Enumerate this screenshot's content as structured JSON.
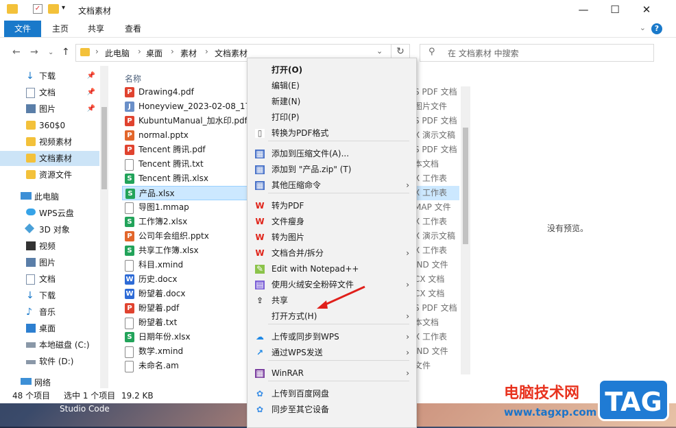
{
  "window": {
    "title": "文档素材"
  },
  "ribbon": {
    "tabs": [
      "文件",
      "主页",
      "共享",
      "查看"
    ],
    "help": "?"
  },
  "address": {
    "crumbs": [
      "此电脑",
      "桌面",
      "素材",
      "文档素材"
    ]
  },
  "search": {
    "placeholder": "在 文档素材 中搜索"
  },
  "nav": {
    "items": [
      {
        "label": "下载",
        "icon": "download-icon",
        "pinned": true
      },
      {
        "label": "文档",
        "icon": "document-icon",
        "pinned": true
      },
      {
        "label": "图片",
        "icon": "picture-icon",
        "pinned": true
      },
      {
        "label": "360$0",
        "icon": "folder-icon",
        "pinned": false
      },
      {
        "label": "视频素材",
        "icon": "folder-icon",
        "pinned": false
      },
      {
        "label": "文档素材",
        "icon": "folder-icon",
        "pinned": false,
        "selected": true
      },
      {
        "label": "资源文件",
        "icon": "folder-icon",
        "pinned": false
      },
      {
        "label": "此电脑",
        "icon": "computer-icon",
        "pinned": false
      },
      {
        "label": "WPS云盘",
        "icon": "cloud-icon",
        "pinned": false
      },
      {
        "label": "3D 对象",
        "icon": "3d-objects-icon",
        "pinned": false
      },
      {
        "label": "视频",
        "icon": "video-icon",
        "pinned": false
      },
      {
        "label": "图片",
        "icon": "picture-icon",
        "pinned": false
      },
      {
        "label": "文档",
        "icon": "document-icon",
        "pinned": false
      },
      {
        "label": "下载",
        "icon": "download-icon",
        "pinned": false
      },
      {
        "label": "音乐",
        "icon": "music-icon",
        "pinned": false
      },
      {
        "label": "桌面",
        "icon": "desktop-icon",
        "pinned": false
      },
      {
        "label": "本地磁盘 (C:)",
        "icon": "drive-icon",
        "pinned": false
      },
      {
        "label": "软件 (D:)",
        "icon": "drive-icon",
        "pinned": false
      },
      {
        "label": "网络",
        "icon": "network-icon",
        "pinned": false
      }
    ]
  },
  "files": {
    "header": "名称",
    "items": [
      {
        "name": "Drawing4.pdf",
        "type": "pdf"
      },
      {
        "name": "Honeyview_2023-02-08_171",
        "type": "jpg"
      },
      {
        "name": "KubuntuManual_加水印.pdf",
        "type": "pdf"
      },
      {
        "name": "normal.pptx",
        "type": "ppt"
      },
      {
        "name": "Tencent 腾讯.pdf",
        "type": "pdf"
      },
      {
        "name": "Tencent 腾讯.txt",
        "type": "txt"
      },
      {
        "name": "Tencent 腾讯.xlsx",
        "type": "xls"
      },
      {
        "name": "产品.xlsx",
        "type": "xls",
        "selected": true
      },
      {
        "name": "导图1.mmap",
        "type": "txt"
      },
      {
        "name": "工作簿2.xlsx",
        "type": "xls"
      },
      {
        "name": "公司年会组织.pptx",
        "type": "ppt"
      },
      {
        "name": "共享工作簿.xlsx",
        "type": "xls"
      },
      {
        "name": "科目.xmind",
        "type": "txt"
      },
      {
        "name": "历史.docx",
        "type": "doc"
      },
      {
        "name": "盼望着.docx",
        "type": "doc"
      },
      {
        "name": "盼望着.pdf",
        "type": "pdf"
      },
      {
        "name": "盼望着.txt",
        "type": "txt"
      },
      {
        "name": "日期年份.xlsx",
        "type": "xls"
      },
      {
        "name": "数学.xmind",
        "type": "txt"
      },
      {
        "name": "未命名.am",
        "type": "txt"
      }
    ]
  },
  "types": [
    "S PDF 文档",
    "图片文件",
    "S PDF 文档",
    "X 演示文稿",
    "S PDF 文档",
    "本文档",
    "X 工作表",
    "X 工作表",
    "MAP 文件",
    "X 工作表",
    "X 演示文稿",
    "X 工作表",
    "IND 文件",
    "CX 文档",
    "CX 文档",
    "S PDF 文档",
    "本文档",
    "X 工作表",
    "IND 文件",
    "文件"
  ],
  "preview": {
    "text": "没有预览。"
  },
  "status": {
    "count": "48 个项目",
    "selected": "选中 1 个项目",
    "size": "19.2 KB"
  },
  "taskbar": {
    "app": "Studio Code"
  },
  "menu": {
    "items": [
      {
        "label": "打开(O)",
        "bold": true
      },
      {
        "label": "编辑(E)"
      },
      {
        "label": "新建(N)"
      },
      {
        "label": "打印(P)"
      },
      {
        "label": "转换为PDF格式",
        "icon": "pdf-convert-icon"
      },
      {
        "label": "添加到压缩文件(A)...",
        "icon": "archive-icon"
      },
      {
        "label": "添加到 \"产品.zip\" (T)",
        "icon": "archive-icon"
      },
      {
        "label": "其他压缩命令",
        "icon": "archive-icon",
        "submenu": true
      },
      {
        "label": "转为PDF",
        "icon": "wps-icon"
      },
      {
        "label": "文件瘦身",
        "icon": "wps-icon"
      },
      {
        "label": "转为图片",
        "icon": "wps-icon"
      },
      {
        "label": "文档合并/拆分",
        "icon": "wps-icon",
        "submenu": true
      },
      {
        "label": "Edit with Notepad++",
        "icon": "notepad-icon"
      },
      {
        "label": "使用火绒安全粉碎文件",
        "icon": "shredder-icon",
        "submenu": true
      },
      {
        "label": "共享",
        "icon": "share-icon"
      },
      {
        "label": "打开方式(H)",
        "submenu": true
      },
      {
        "label": "上传或同步到WPS",
        "icon": "cloud-icon",
        "submenu": true
      },
      {
        "label": "通过WPS发送",
        "icon": "send-icon",
        "submenu": true
      },
      {
        "label": "WinRAR",
        "icon": "winrar-icon",
        "submenu": true
      },
      {
        "label": "上传到百度网盘",
        "icon": "baidu-icon"
      },
      {
        "label": "同步至其它设备",
        "icon": "baidu-icon"
      }
    ]
  },
  "watermark": {
    "line1": "电脑技术网",
    "line2": "www.tagxp.com",
    "tag": "TAG"
  },
  "colors": {
    "accent": "#1979ca",
    "selection": "#cce8ff",
    "pdf": "#e0432f",
    "xls": "#22a35a",
    "doc": "#2e6bd6",
    "ppt": "#e2662b"
  }
}
